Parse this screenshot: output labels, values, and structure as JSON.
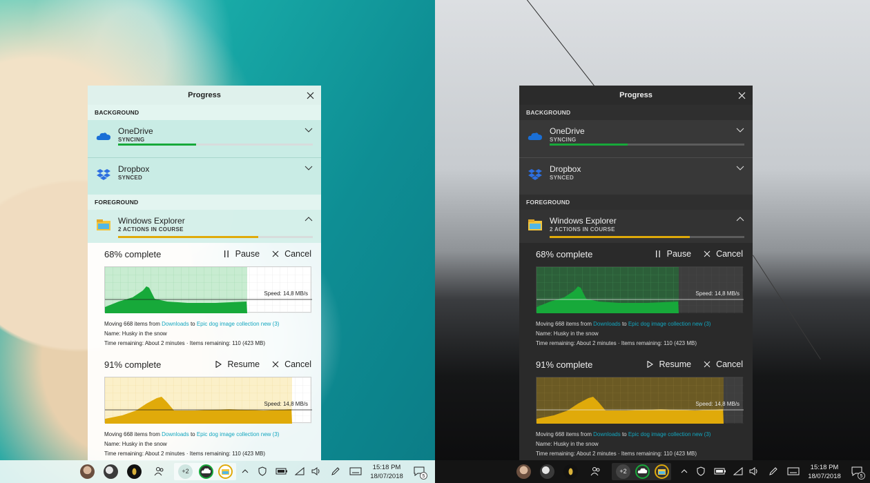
{
  "panel": {
    "title": "Progress",
    "sections": {
      "background": "BACKGROUND",
      "foreground": "FOREGROUND"
    },
    "background_items": [
      {
        "name": "OneDrive",
        "status": "SYNCING",
        "progress": 0.4
      },
      {
        "name": "Dropbox",
        "status": "SYNCED"
      }
    ],
    "foreground_item": {
      "name": "Windows Explorer",
      "status": "2 ACTIONS IN COURSE",
      "progress": 0.72
    },
    "jobs": [
      {
        "percent_text": "68% complete",
        "primary_action": "Pause",
        "cancel_label": "Cancel",
        "fill_fraction": 0.68,
        "speed": "Speed: 14,8 MB/s",
        "moving_prefix": "Moving 668 items from ",
        "source": "Downloads",
        "to_word": " to ",
        "destination": "Epic dog image collection new (3)",
        "name_line": "Name: Husky in the snow",
        "time_line": "Time remaining: About 2 minutes · Items remaining: 110 (423 MB)"
      },
      {
        "percent_text": "91% complete",
        "primary_action": "Resume",
        "cancel_label": "Cancel",
        "fill_fraction": 0.91,
        "speed": "Speed: 14,8 MB/s",
        "moving_prefix": "Moving 668 items from ",
        "source": "Downloads",
        "to_word": " to ",
        "destination": "Epic dog image collection new (3)",
        "name_line": "Name: Husky in the snow",
        "time_line": "Time remaining: About 2 minutes · Items remaining: 110 (423 MB)"
      }
    ]
  },
  "taskbar": {
    "overflow_count": "+2",
    "time": "15:18 PM",
    "date": "18/07/2018",
    "notification_count": "5"
  },
  "colors": {
    "onedrive_blue": "#1a6fd6",
    "dropbox_blue": "#2d6fe0",
    "green_fill": "#17a93a",
    "yellow_fill": "#e0aa0a",
    "link": "#12a6bf"
  }
}
